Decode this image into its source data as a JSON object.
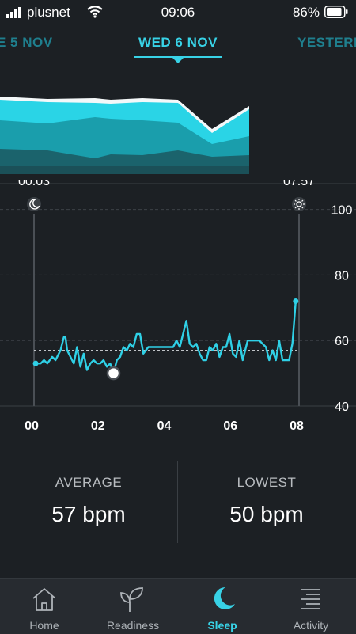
{
  "status": {
    "carrier": "plusnet",
    "time": "09:06",
    "battery": "86%"
  },
  "date_tabs": {
    "prev": "E 5 NOV",
    "current": "WED 6 NOV",
    "next": "YESTERD"
  },
  "colors": {
    "accent": "#38d2e6",
    "background": "#1c2024",
    "tab_bar": "#272b30"
  },
  "chart_data": {
    "type": "line",
    "title": "",
    "xlabel": "",
    "ylabel": "",
    "x_ticks": [
      "00",
      "02",
      "04",
      "06",
      "08"
    ],
    "y_ticks": [
      "40",
      "60",
      "80",
      "100"
    ],
    "ylim": [
      40,
      104
    ],
    "xlim": [
      0,
      8
    ],
    "average_line": 57,
    "lowest_point": {
      "x": 2.4,
      "y": 50
    },
    "sleep_start_label": "00:03",
    "wake_label": "07:57",
    "series": [
      {
        "x": [
          0.05,
          0.2,
          0.3,
          0.4,
          0.55,
          0.65,
          0.8,
          0.9,
          0.95,
          1.0,
          1.1,
          1.2,
          1.3,
          1.4,
          1.5,
          1.6,
          1.7,
          1.8,
          1.9,
          2.0,
          2.1,
          2.2,
          2.3,
          2.4,
          2.5,
          2.6,
          2.7,
          2.8,
          2.9,
          3.0,
          3.1,
          3.2,
          3.3,
          3.45,
          3.6,
          3.8,
          4.0,
          4.2,
          4.3,
          4.4,
          4.5,
          4.6,
          4.7,
          4.8,
          4.9,
          5.0,
          5.1,
          5.2,
          5.3,
          5.4,
          5.5,
          5.6,
          5.7,
          5.8,
          5.9,
          6.0,
          6.1,
          6.2,
          6.3,
          6.45,
          6.6,
          6.8,
          7.0,
          7.1,
          7.2,
          7.3,
          7.4,
          7.5,
          7.6,
          7.7,
          7.8,
          7.9
        ],
        "y": [
          53,
          53,
          54,
          53,
          55,
          54,
          57,
          61,
          61,
          57,
          55,
          53,
          58,
          52,
          56,
          51,
          53,
          54,
          53,
          53,
          54,
          52,
          53,
          50,
          54,
          55,
          58,
          57,
          59,
          58,
          62,
          62,
          56,
          58,
          58,
          58,
          58,
          58,
          60,
          58,
          62,
          66,
          59,
          58,
          59,
          56,
          54,
          54,
          58,
          57,
          59,
          55,
          58,
          58,
          62,
          56,
          55,
          60,
          54,
          60,
          60,
          60,
          58,
          54,
          57,
          54,
          60,
          54,
          54,
          54,
          59,
          72
        ]
      }
    ]
  },
  "stats": {
    "average_label": "AVERAGE",
    "average_value": "57 bpm",
    "lowest_label": "LOWEST",
    "lowest_value": "50 bpm"
  },
  "nav": [
    {
      "label": "Home",
      "icon": "home-icon"
    },
    {
      "label": "Readiness",
      "icon": "sprout-icon"
    },
    {
      "label": "Sleep",
      "icon": "moon-icon",
      "active": true
    },
    {
      "label": "Activity",
      "icon": "activity-list-icon"
    }
  ]
}
